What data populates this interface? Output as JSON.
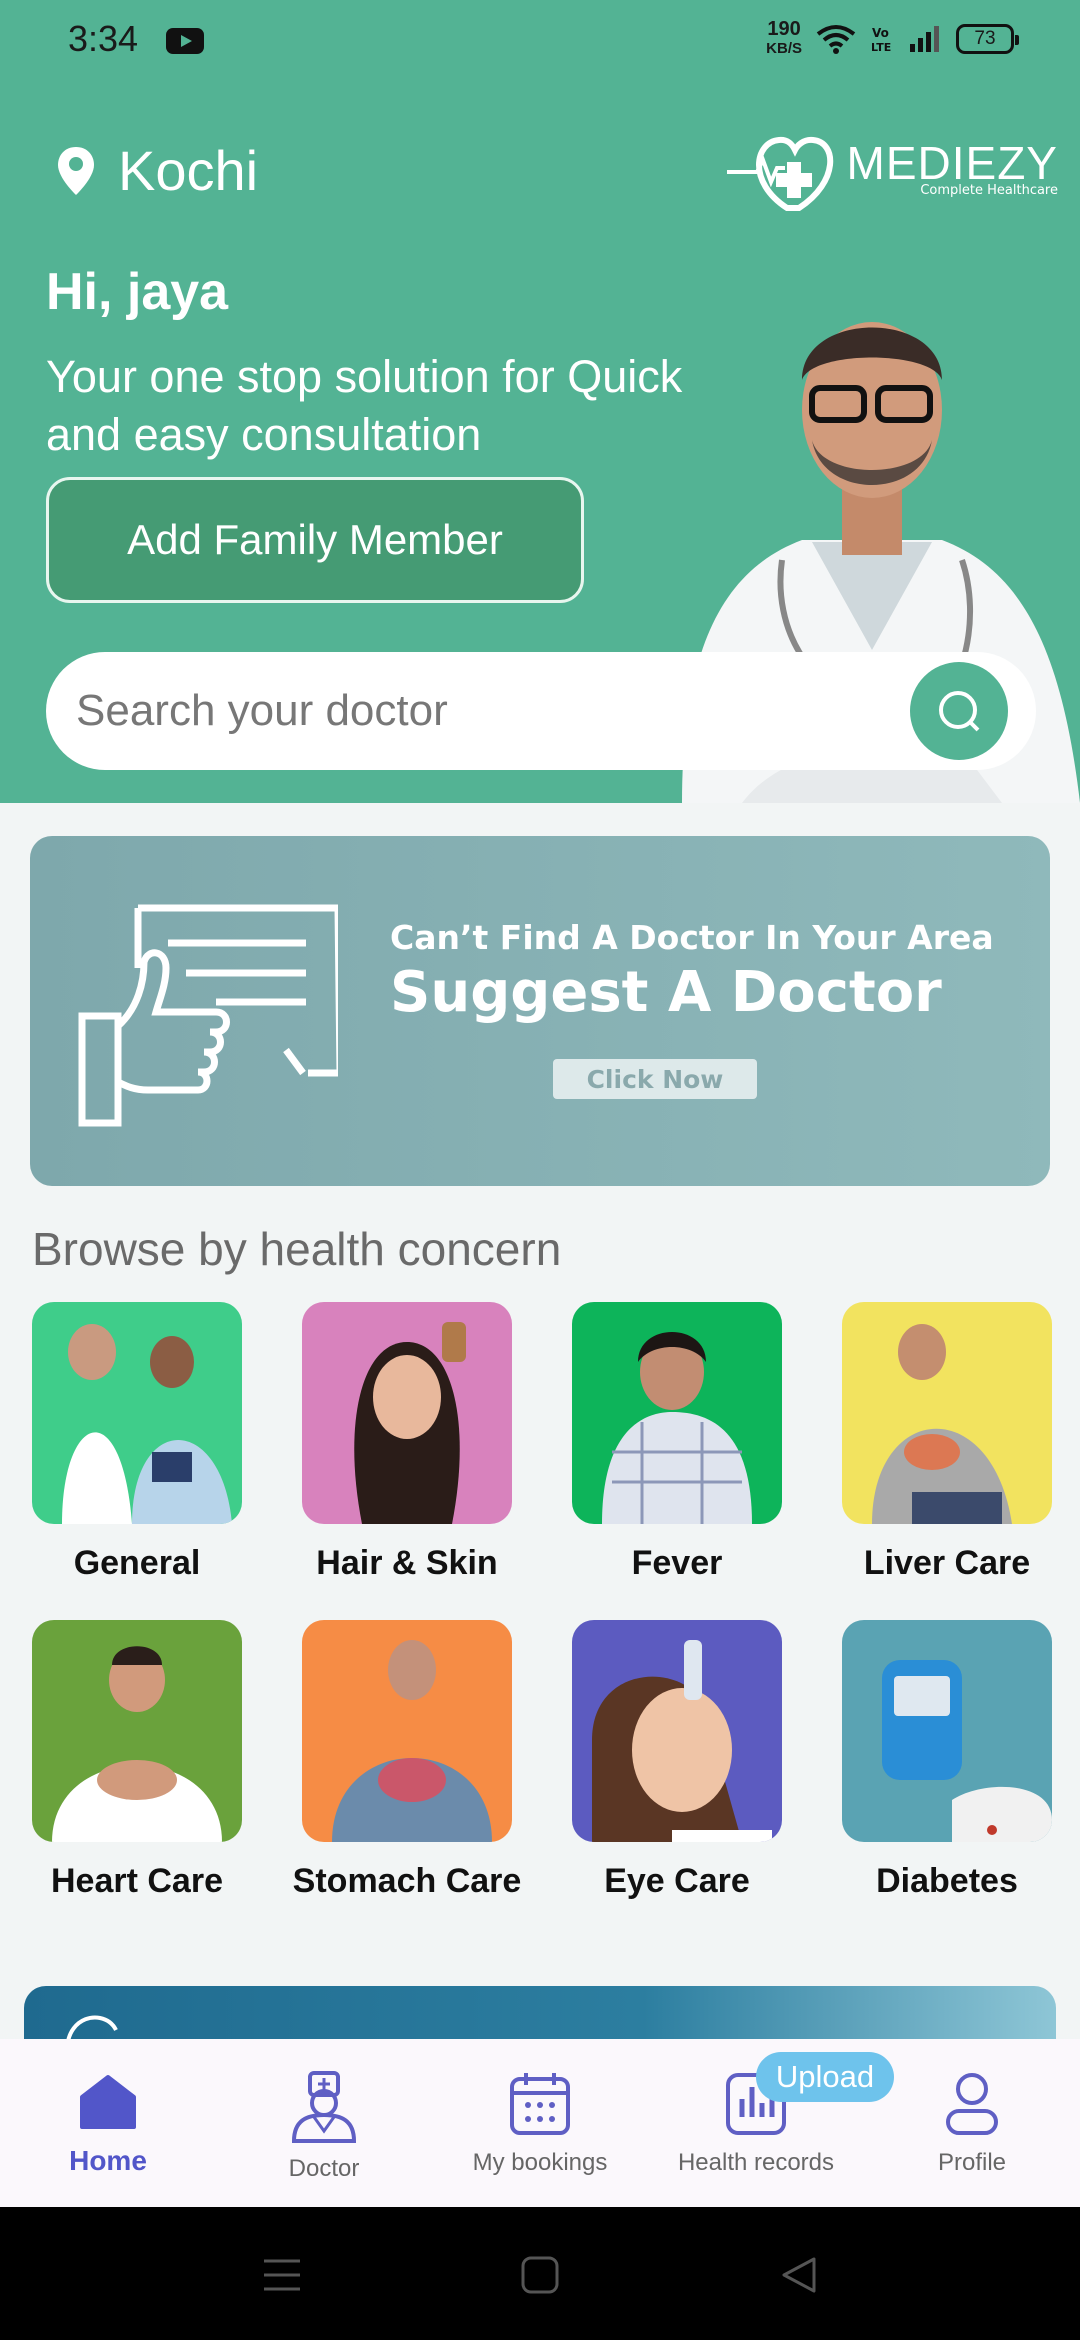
{
  "status_bar": {
    "time": "3:34",
    "speed_value": "190",
    "speed_unit": "KB/S",
    "battery": "73"
  },
  "header": {
    "location": "Kochi",
    "logo_word": "MEDIEZY",
    "logo_tagline": "Complete Healthcare"
  },
  "hero": {
    "greeting": "Hi, jaya",
    "tagline": "Your one stop solution for Quick and easy consultation",
    "add_family_label": "Add Family Member"
  },
  "search": {
    "placeholder": "Search your doctor"
  },
  "suggest_banner": {
    "subtitle": "Can’t Find A Doctor In Your Area",
    "title": "Suggest A Doctor",
    "button": "Click Now"
  },
  "health_concerns": {
    "title": "Browse by health concern",
    "items": [
      {
        "label": "General",
        "color": "#3fcd8a"
      },
      {
        "label": "Hair & Skin",
        "color": "#d882bd"
      },
      {
        "label": "Fever",
        "color": "#0db45a"
      },
      {
        "label": "Liver Care",
        "color": "#f2e35f"
      },
      {
        "label": "Heart Care",
        "color": "#6aa23c"
      },
      {
        "label": "Stomach Care",
        "color": "#f68c45"
      },
      {
        "label": "Eye Care",
        "color": "#5c5bc0"
      },
      {
        "label": "Diabetes",
        "color": "#5aa3b3"
      }
    ]
  },
  "bottom_nav": {
    "items": [
      {
        "label": "Home",
        "icon": "home-icon"
      },
      {
        "label": "Doctor",
        "icon": "doctor-icon"
      },
      {
        "label": "My bookings",
        "icon": "calendar-icon"
      },
      {
        "label": "Health records",
        "icon": "chart-icon"
      },
      {
        "label": "Profile",
        "icon": "profile-icon"
      }
    ],
    "upload_badge": "Upload"
  },
  "colors": {
    "brand": "#53b394",
    "nav_accent": "#5f5fc4"
  }
}
